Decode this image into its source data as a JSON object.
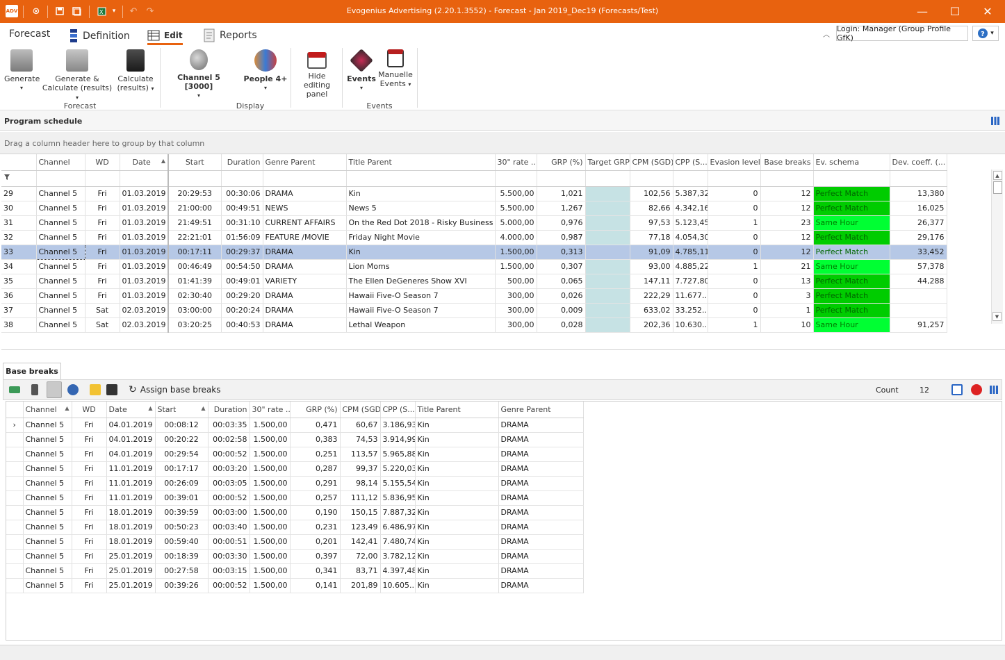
{
  "window": {
    "title": "Evogenius Advertising (2.20.1.3552) - Forecast - Jan 2019_Dec19 (Forecasts/Test)",
    "app_badge": "ADV",
    "controls": {
      "minimize": "—",
      "maximize": "☐",
      "close": "✕"
    }
  },
  "ribbon_tabs": [
    "Forecast",
    "Definition",
    "Edit",
    "Reports"
  ],
  "login_label": "Login: Manager (Group Profile GfK)",
  "ribbon": {
    "generate": "Generate",
    "generate_calc_1": "Generate &",
    "generate_calc_2": "Calculate (results)",
    "calculate_1": "Calculate",
    "calculate_2": "(results)",
    "channel": "Channel 5 [3000]",
    "people": "People 4+",
    "hide_1": "Hide editing",
    "hide_2": "panel",
    "events": "Events",
    "manuelle_1": "Manuelle",
    "manuelle_2": "Events",
    "group_forecast": "Forecast",
    "group_display": "Display",
    "group_events": "Events"
  },
  "program_schedule": {
    "title": "Program schedule",
    "group_hint": "Drag a column header here to group by that column",
    "columns": [
      "Channel",
      "WD",
      "Date",
      "Start",
      "Duration",
      "Genre Parent",
      "Title Parent",
      "30\" rate ...",
      "GRP (%)",
      "Target GRP",
      "CPM (SGD)",
      "CPP (S...",
      "Evasion levels",
      "Base breaks",
      "Ev. schema",
      "Dev. coeff. (..."
    ],
    "rows": [
      {
        "n": "29",
        "ch": "Channel 5",
        "wd": "Fri",
        "date": "01.03.2019",
        "start": "20:29:53",
        "dur": "00:30:06",
        "genre": "DRAMA",
        "title": "Kin",
        "rate": "5.500,00",
        "grp": "1,021",
        "cpm": "102,56",
        "cpp": "5.387,32",
        "ev": "0",
        "bb": "12",
        "schema": "Perfect Match",
        "dev": "13,380"
      },
      {
        "n": "30",
        "ch": "Channel 5",
        "wd": "Fri",
        "date": "01.03.2019",
        "start": "21:00:00",
        "dur": "00:49:51",
        "genre": "NEWS",
        "title": "News 5",
        "rate": "5.500,00",
        "grp": "1,267",
        "cpm": "82,66",
        "cpp": "4.342,16",
        "ev": "0",
        "bb": "12",
        "schema": "Perfect Match",
        "dev": "16,025"
      },
      {
        "n": "31",
        "ch": "Channel 5",
        "wd": "Fri",
        "date": "01.03.2019",
        "start": "21:49:51",
        "dur": "00:31:10",
        "genre": "CURRENT AFFAIRS",
        "title": "On the Red Dot 2018 - Risky Business",
        "rate": "5.000,00",
        "grp": "0,976",
        "cpm": "97,53",
        "cpp": "5.123,45",
        "ev": "1",
        "bb": "23",
        "schema": "Same Hour",
        "dev": "26,377"
      },
      {
        "n": "32",
        "ch": "Channel 5",
        "wd": "Fri",
        "date": "01.03.2019",
        "start": "22:21:01",
        "dur": "01:56:09",
        "genre": "FEATURE /MOVIE",
        "title": "Friday Night Movie",
        "rate": "4.000,00",
        "grp": "0,987",
        "cpm": "77,18",
        "cpp": "4.054,30",
        "ev": "0",
        "bb": "12",
        "schema": "Perfect Match",
        "dev": "29,176"
      },
      {
        "n": "33",
        "ch": "Channel 5",
        "wd": "Fri",
        "date": "01.03.2019",
        "start": "00:17:11",
        "dur": "00:29:37",
        "genre": "DRAMA",
        "title": "Kin",
        "rate": "1.500,00",
        "grp": "0,313",
        "cpm": "91,09",
        "cpp": "4.785,11",
        "ev": "0",
        "bb": "12",
        "schema": "Perfect Match",
        "dev": "33,452",
        "selected": true
      },
      {
        "n": "34",
        "ch": "Channel 5",
        "wd": "Fri",
        "date": "01.03.2019",
        "start": "00:46:49",
        "dur": "00:54:50",
        "genre": "DRAMA",
        "title": "Lion Moms",
        "rate": "1.500,00",
        "grp": "0,307",
        "cpm": "93,00",
        "cpp": "4.885,22",
        "ev": "1",
        "bb": "21",
        "schema": "Same Hour",
        "dev": "57,378"
      },
      {
        "n": "35",
        "ch": "Channel 5",
        "wd": "Fri",
        "date": "01.03.2019",
        "start": "01:41:39",
        "dur": "00:49:01",
        "genre": "VARIETY",
        "title": "The Ellen DeGeneres Show XVI",
        "rate": "500,00",
        "grp": "0,065",
        "cpm": "147,11",
        "cpp": "7.727,80",
        "ev": "0",
        "bb": "13",
        "schema": "Perfect Match",
        "dev": "44,288"
      },
      {
        "n": "36",
        "ch": "Channel 5",
        "wd": "Fri",
        "date": "01.03.2019",
        "start": "02:30:40",
        "dur": "00:29:20",
        "genre": "DRAMA",
        "title": "Hawaii Five-O Season 7",
        "rate": "300,00",
        "grp": "0,026",
        "cpm": "222,29",
        "cpp": "11.677...",
        "ev": "0",
        "bb": "3",
        "schema": "Perfect Match",
        "dev": ""
      },
      {
        "n": "37",
        "ch": "Channel 5",
        "wd": "Sat",
        "date": "02.03.2019",
        "start": "03:00:00",
        "dur": "00:20:24",
        "genre": "DRAMA",
        "title": "Hawaii Five-O Season 7",
        "rate": "300,00",
        "grp": "0,009",
        "cpm": "633,02",
        "cpp": "33.252...",
        "ev": "0",
        "bb": "1",
        "schema": "Perfect Match",
        "dev": ""
      },
      {
        "n": "38",
        "ch": "Channel 5",
        "wd": "Sat",
        "date": "02.03.2019",
        "start": "03:20:25",
        "dur": "00:40:53",
        "genre": "DRAMA",
        "title": "Lethal Weapon",
        "rate": "300,00",
        "grp": "0,028",
        "cpm": "202,36",
        "cpp": "10.630...",
        "ev": "1",
        "bb": "10",
        "schema": "Same Hour",
        "dev": "91,257"
      }
    ]
  },
  "base_breaks": {
    "tab": "Base breaks",
    "assign": "Assign base breaks",
    "count_label": "Count",
    "count_value": "12",
    "columns": [
      "Channel",
      "WD",
      "Date",
      "Start",
      "Duration",
      "30\" rate ...",
      "GRP (%)",
      "CPM (SGD)",
      "CPP (S...",
      "Title Parent",
      "Genre Parent"
    ],
    "rows": [
      {
        "ch": "Channel 5",
        "wd": "Fri",
        "date": "04.01.2019",
        "start": "00:08:12",
        "dur": "00:03:35",
        "rate": "1.500,00",
        "grp": "0,471",
        "cpm": "60,67",
        "cpp": "3.186,93",
        "title": "Kin",
        "genre": "DRAMA"
      },
      {
        "ch": "Channel 5",
        "wd": "Fri",
        "date": "04.01.2019",
        "start": "00:20:22",
        "dur": "00:02:58",
        "rate": "1.500,00",
        "grp": "0,383",
        "cpm": "74,53",
        "cpp": "3.914,99",
        "title": "Kin",
        "genre": "DRAMA"
      },
      {
        "ch": "Channel 5",
        "wd": "Fri",
        "date": "04.01.2019",
        "start": "00:29:54",
        "dur": "00:00:52",
        "rate": "1.500,00",
        "grp": "0,251",
        "cpm": "113,57",
        "cpp": "5.965,88",
        "title": "Kin",
        "genre": "DRAMA"
      },
      {
        "ch": "Channel 5",
        "wd": "Fri",
        "date": "11.01.2019",
        "start": "00:17:17",
        "dur": "00:03:20",
        "rate": "1.500,00",
        "grp": "0,287",
        "cpm": "99,37",
        "cpp": "5.220,03",
        "title": "Kin",
        "genre": "DRAMA"
      },
      {
        "ch": "Channel 5",
        "wd": "Fri",
        "date": "11.01.2019",
        "start": "00:26:09",
        "dur": "00:03:05",
        "rate": "1.500,00",
        "grp": "0,291",
        "cpm": "98,14",
        "cpp": "5.155,54",
        "title": "Kin",
        "genre": "DRAMA"
      },
      {
        "ch": "Channel 5",
        "wd": "Fri",
        "date": "11.01.2019",
        "start": "00:39:01",
        "dur": "00:00:52",
        "rate": "1.500,00",
        "grp": "0,257",
        "cpm": "111,12",
        "cpp": "5.836,95",
        "title": "Kin",
        "genre": "DRAMA"
      },
      {
        "ch": "Channel 5",
        "wd": "Fri",
        "date": "18.01.2019",
        "start": "00:39:59",
        "dur": "00:03:00",
        "rate": "1.500,00",
        "grp": "0,190",
        "cpm": "150,15",
        "cpp": "7.887,32",
        "title": "Kin",
        "genre": "DRAMA"
      },
      {
        "ch": "Channel 5",
        "wd": "Fri",
        "date": "18.01.2019",
        "start": "00:50:23",
        "dur": "00:03:40",
        "rate": "1.500,00",
        "grp": "0,231",
        "cpm": "123,49",
        "cpp": "6.486,97",
        "title": "Kin",
        "genre": "DRAMA"
      },
      {
        "ch": "Channel 5",
        "wd": "Fri",
        "date": "18.01.2019",
        "start": "00:59:40",
        "dur": "00:00:51",
        "rate": "1.500,00",
        "grp": "0,201",
        "cpm": "142,41",
        "cpp": "7.480,74",
        "title": "Kin",
        "genre": "DRAMA"
      },
      {
        "ch": "Channel 5",
        "wd": "Fri",
        "date": "25.01.2019",
        "start": "00:18:39",
        "dur": "00:03:30",
        "rate": "1.500,00",
        "grp": "0,397",
        "cpm": "72,00",
        "cpp": "3.782,12",
        "title": "Kin",
        "genre": "DRAMA"
      },
      {
        "ch": "Channel 5",
        "wd": "Fri",
        "date": "25.01.2019",
        "start": "00:27:58",
        "dur": "00:03:15",
        "rate": "1.500,00",
        "grp": "0,341",
        "cpm": "83,71",
        "cpp": "4.397,48",
        "title": "Kin",
        "genre": "DRAMA"
      },
      {
        "ch": "Channel 5",
        "wd": "Fri",
        "date": "25.01.2019",
        "start": "00:39:26",
        "dur": "00:00:52",
        "rate": "1.500,00",
        "grp": "0,141",
        "cpm": "201,89",
        "cpp": "10.605...",
        "title": "Kin",
        "genre": "DRAMA"
      }
    ]
  },
  "colors": {
    "accent": "#e8620f",
    "perfect_match": "#00cc00",
    "same_hour": "#00ff33",
    "target_grp": "#c6e2e4",
    "selection": "#b6c8e6"
  }
}
